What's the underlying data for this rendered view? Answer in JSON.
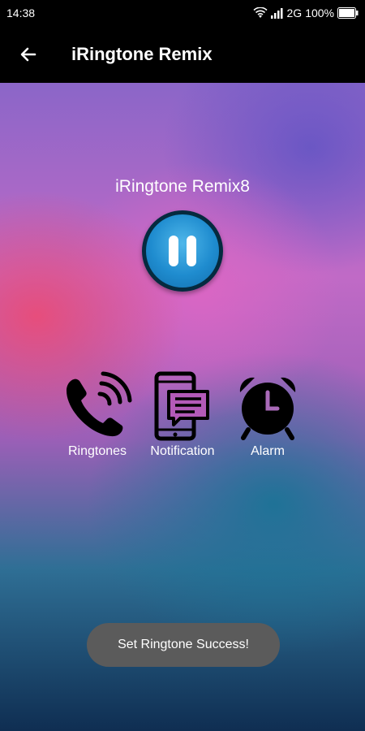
{
  "status_bar": {
    "time": "14:38",
    "network": "2G",
    "battery": "100%"
  },
  "app_bar": {
    "title": "iRingtone Remix"
  },
  "player": {
    "track_title": "iRingtone Remix8",
    "state": "playing"
  },
  "options": [
    {
      "label": "Ringtones",
      "icon": "phone-ringing-icon"
    },
    {
      "label": "Notification",
      "icon": "phone-message-icon"
    },
    {
      "label": "Alarm",
      "icon": "alarm-clock-icon"
    }
  ],
  "toast": {
    "message": "Set Ringtone Success!"
  },
  "colors": {
    "play_button": "#1f8ccf",
    "bar_background": "#000000",
    "toast_background": "#5b5b5b"
  }
}
